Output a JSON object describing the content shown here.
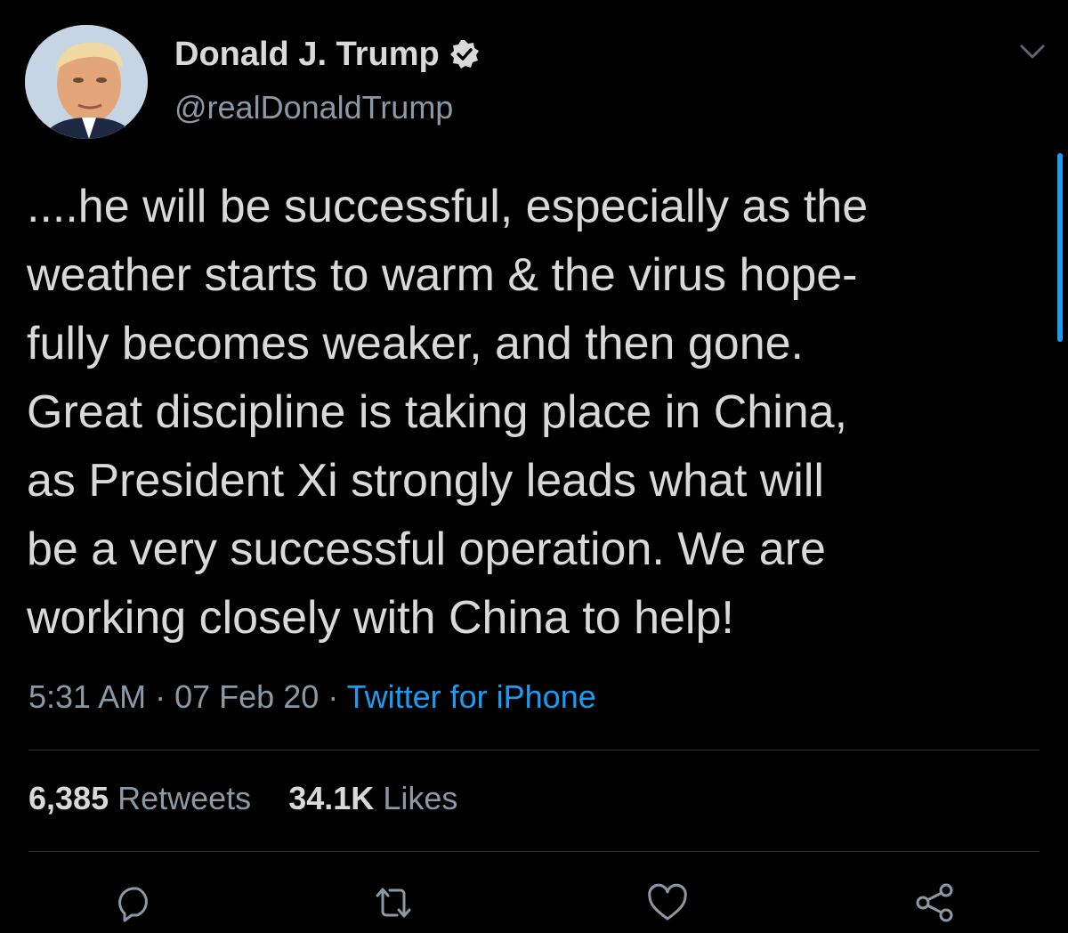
{
  "author": {
    "display_name": "Donald J. Trump",
    "handle": "@realDonaldTrump",
    "verified": true
  },
  "tweet": {
    "text": "....he will be successful, especially as the\nweather starts to warm & the virus hope-\nfully becomes weaker, and then gone.\nGreat discipline is taking place in China,\nas President Xi strongly leads what will\nbe a very successful operation. We are\nworking closely with China to help!",
    "time": "5:31 AM",
    "date": "07 Feb 20",
    "separator": "·",
    "source": "Twitter for iPhone"
  },
  "stats": {
    "retweets_count": "6,385",
    "retweets_label": "Retweets",
    "likes_count": "34.1K",
    "likes_label": "Likes"
  },
  "actions": [
    {
      "icon": "reply-icon"
    },
    {
      "icon": "retweet-icon"
    },
    {
      "icon": "like-icon"
    },
    {
      "icon": "share-icon"
    }
  ],
  "colors": {
    "background": "#000000",
    "text": "#d9d9d9",
    "secondary_text": "#8b98a5",
    "link": "#1d9bf0",
    "divider": "#2f3336"
  }
}
